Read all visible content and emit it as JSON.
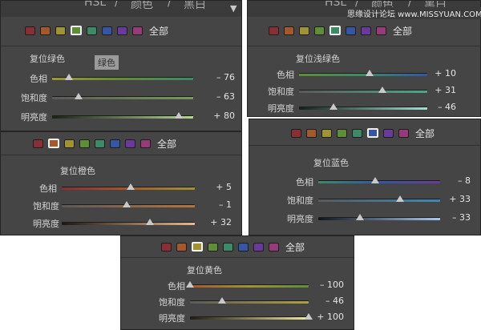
{
  "header_tabs": {
    "hsl": "HSL",
    "slash": "/",
    "color": "颜色",
    "bw": "黑白",
    "arrow": "▼"
  },
  "watermark": "思缘设计论坛 www.MISSYUAN.COM",
  "swatch_colors": [
    "#8a2e36",
    "#a4582c",
    "#a09432",
    "#5e8e36",
    "#3c8a66",
    "#3456a4",
    "#6a3a9a",
    "#963a7a"
  ],
  "all_label": "全部",
  "tooltip": "绿色",
  "panels": [
    {
      "id": "green",
      "selected": 3,
      "title": "复位绿色",
      "rows": [
        {
          "label": "色相",
          "value": "– 76",
          "pos": 0.12,
          "grad": "linear-gradient(90deg,#a09432,#5e8e36,#3c8a66)"
        },
        {
          "label": "饱和度",
          "value": "– 63",
          "pos": 0.19,
          "grad": "linear-gradient(90deg,#5a5a5a,#7a9858)"
        },
        {
          "label": "明亮度",
          "value": "+ 80",
          "pos": 0.9,
          "grad": "linear-gradient(90deg,#1c2214,#b0d890)"
        }
      ]
    },
    {
      "id": "aqua",
      "selected": 4,
      "title": "复位浅绿色",
      "rows": [
        {
          "label": "色相",
          "value": "+ 10",
          "pos": 0.55,
          "grad": "linear-gradient(90deg,#5e8e36,#3c8a66,#3456a4)"
        },
        {
          "label": "饱和度",
          "value": "+ 31",
          "pos": 0.65,
          "grad": "linear-gradient(90deg,#5a5a5a,#4aa88a)"
        },
        {
          "label": "明亮度",
          "value": "– 46",
          "pos": 0.27,
          "grad": "linear-gradient(90deg,#14201c,#a0e0d0)"
        }
      ]
    },
    {
      "id": "orange",
      "selected": 1,
      "title": "复位橙色",
      "rows": [
        {
          "label": "色相",
          "value": "+ 5",
          "pos": 0.52,
          "grad": "linear-gradient(90deg,#8a2e36,#a4582c,#a09432)"
        },
        {
          "label": "饱和度",
          "value": "– 1",
          "pos": 0.49,
          "grad": "linear-gradient(90deg,#5a5a5a,#b8743c)"
        },
        {
          "label": "明亮度",
          "value": "+ 32",
          "pos": 0.66,
          "grad": "linear-gradient(90deg,#201610,#e8b890)"
        }
      ]
    },
    {
      "id": "blue",
      "selected": 5,
      "title": "复位蓝色",
      "rows": [
        {
          "label": "色相",
          "value": "– 8",
          "pos": 0.47,
          "grad": "linear-gradient(90deg,#3c8a66,#3456a4,#6a3a9a)"
        },
        {
          "label": "饱和度",
          "value": "+ 33",
          "pos": 0.67,
          "grad": "linear-gradient(90deg,#5a5a5a,#3a8ab8)"
        },
        {
          "label": "明亮度",
          "value": "– 33",
          "pos": 0.34,
          "grad": "linear-gradient(90deg,#10141e,#a8c8f0)"
        }
      ]
    },
    {
      "id": "yellow",
      "selected": 2,
      "title": "复位黄色",
      "rows": [
        {
          "label": "色相",
          "value": "– 100",
          "pos": 0.0,
          "grad": "linear-gradient(90deg,#a4582c,#a09432,#5e8e36)"
        },
        {
          "label": "饱和度",
          "value": "– 46",
          "pos": 0.27,
          "grad": "linear-gradient(90deg,#5a5a5a,#b0a040)"
        },
        {
          "label": "明亮度",
          "value": "+ 100",
          "pos": 1.0,
          "grad": "linear-gradient(90deg,#1e1c10,#f0e8a0)"
        }
      ]
    }
  ]
}
